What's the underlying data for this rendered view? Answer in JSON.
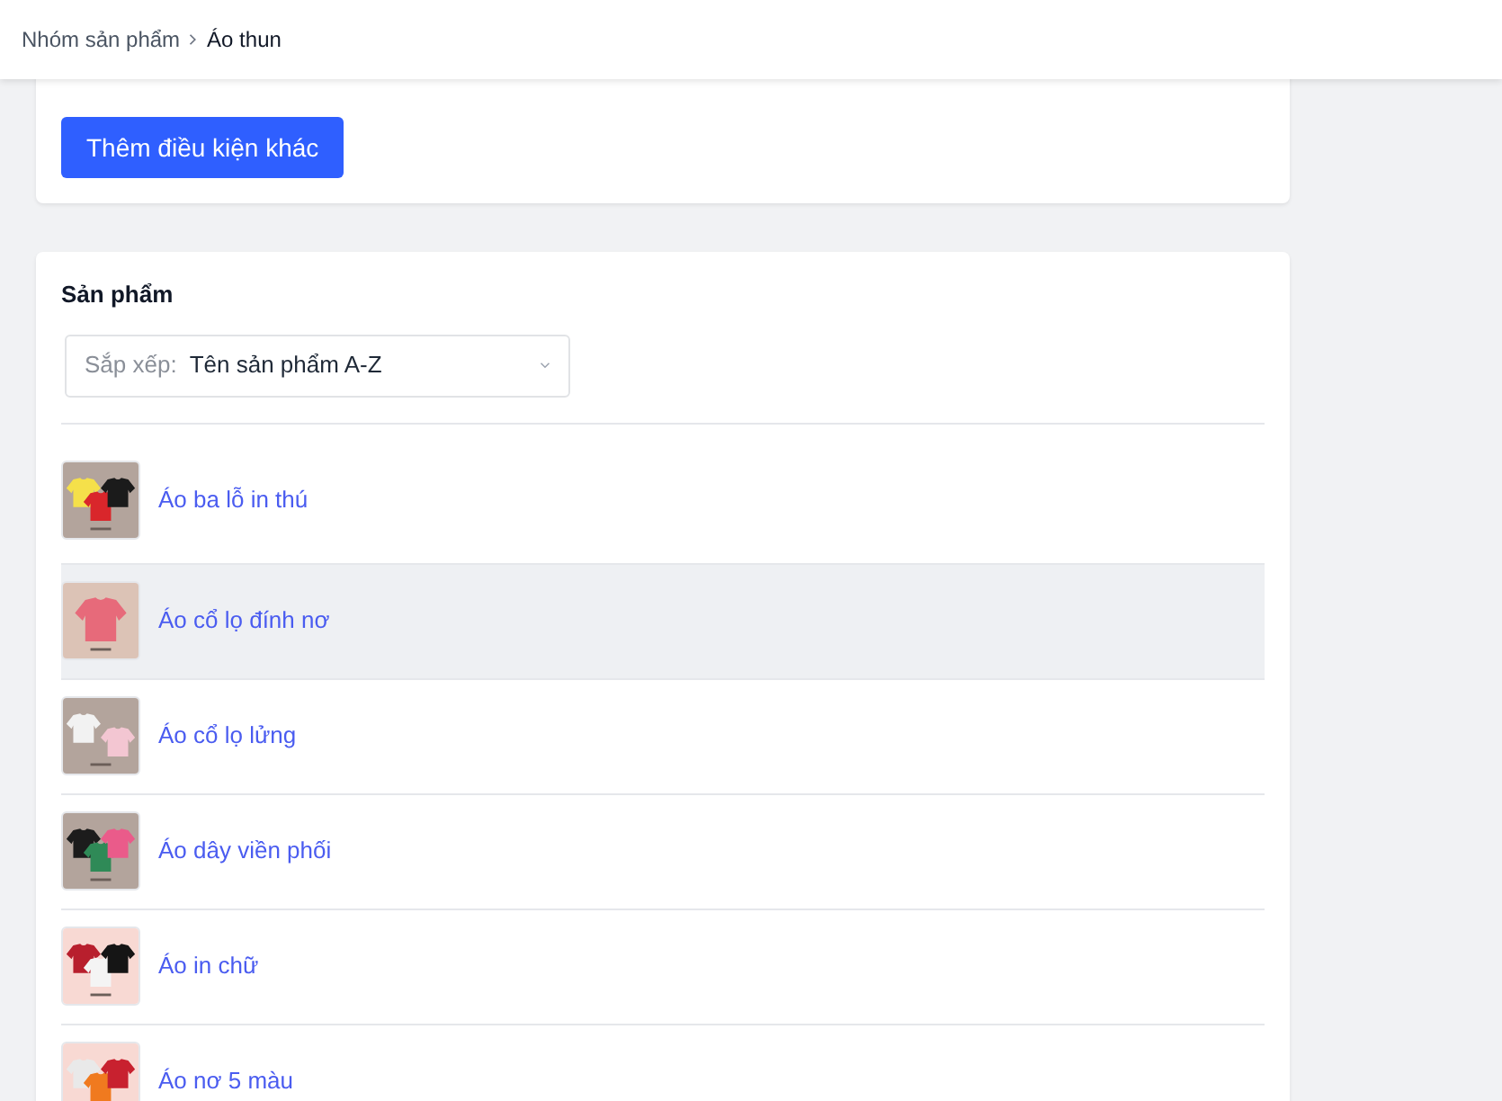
{
  "breadcrumb": [
    {
      "label": "Nhóm sản phẩm",
      "current": false
    },
    {
      "label": "Áo thun",
      "current": true
    }
  ],
  "conditions_card": {
    "add_button": "Thêm điều kiện khác"
  },
  "products_card": {
    "title": "Sản phẩm",
    "sort": {
      "label": "Sắp xếp:",
      "value": "Tên sản phẩm A-Z"
    },
    "items": [
      {
        "name": "Áo ba lỗ in thú",
        "highlighted": false,
        "kind": "picture"
      },
      {
        "name": "Áo cổ lọ đính nơ",
        "highlighted": true,
        "kind": "picture"
      },
      {
        "name": "Áo cổ lọ lửng",
        "highlighted": false,
        "kind": "picture"
      },
      {
        "name": "Áo dây viền phối",
        "highlighted": false,
        "kind": "picture"
      },
      {
        "name": "Áo in chữ",
        "highlighted": false,
        "kind": "picture"
      },
      {
        "name": "Áo nơ 5 màu",
        "highlighted": false,
        "kind": "picture"
      }
    ]
  }
}
